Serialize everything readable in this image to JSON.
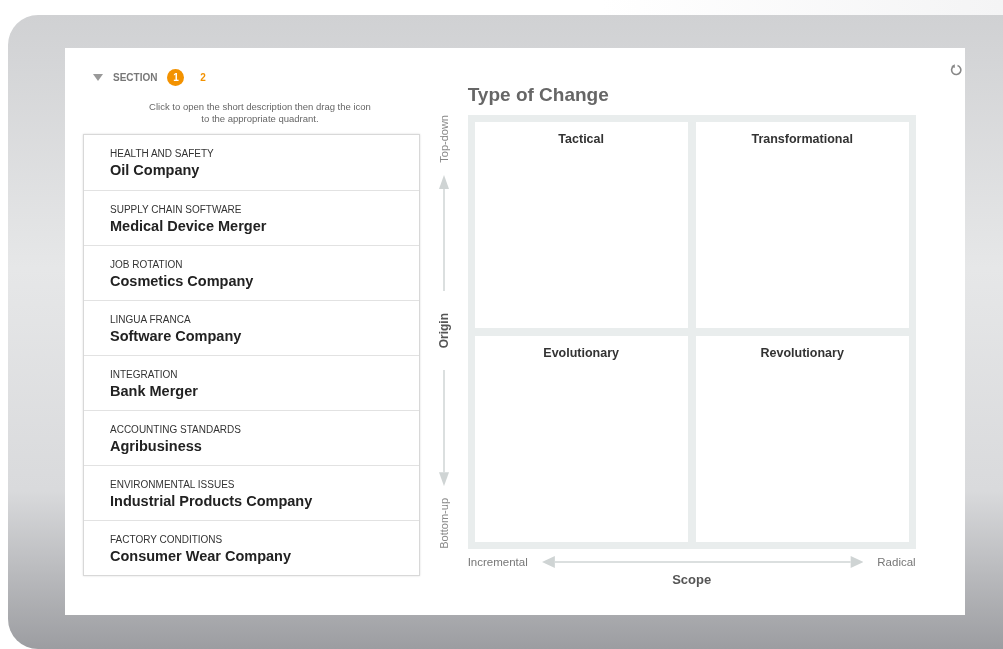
{
  "header": {
    "label": "SECTION",
    "expanded": true,
    "sections": [
      {
        "label": "1",
        "selected": true
      },
      {
        "label": "2",
        "selected": false
      }
    ]
  },
  "instructions": "Click to open the short description then drag the icon to the appropriate quadrant.",
  "cases": [
    {
      "category": "HEALTH AND SAFETY",
      "title": "Oil Company"
    },
    {
      "category": "SUPPLY CHAIN SOFTWARE",
      "title": "Medical Device Merger"
    },
    {
      "category": "JOB ROTATION",
      "title": "Cosmetics Company"
    },
    {
      "category": "LINGUA FRANCA",
      "title": "Software Company"
    },
    {
      "category": "INTEGRATION",
      "title": "Bank Merger"
    },
    {
      "category": "ACCOUNTING STANDARDS",
      "title": "Agribusiness"
    },
    {
      "category": "ENVIRONMENTAL ISSUES",
      "title": "Industrial Products Company"
    },
    {
      "category": "FACTORY CONDITIONS",
      "title": "Consumer Wear Company"
    }
  ],
  "matrix": {
    "title": "Type of Change",
    "y_axis": {
      "label": "Origin",
      "top": "Top-down",
      "bottom": "Bottom-up"
    },
    "x_axis": {
      "label": "Scope",
      "left": "Incremental",
      "right": "Radical"
    },
    "quadrants": [
      "Tactical",
      "Transformational",
      "Evolutionary",
      "Revolutionary"
    ]
  }
}
